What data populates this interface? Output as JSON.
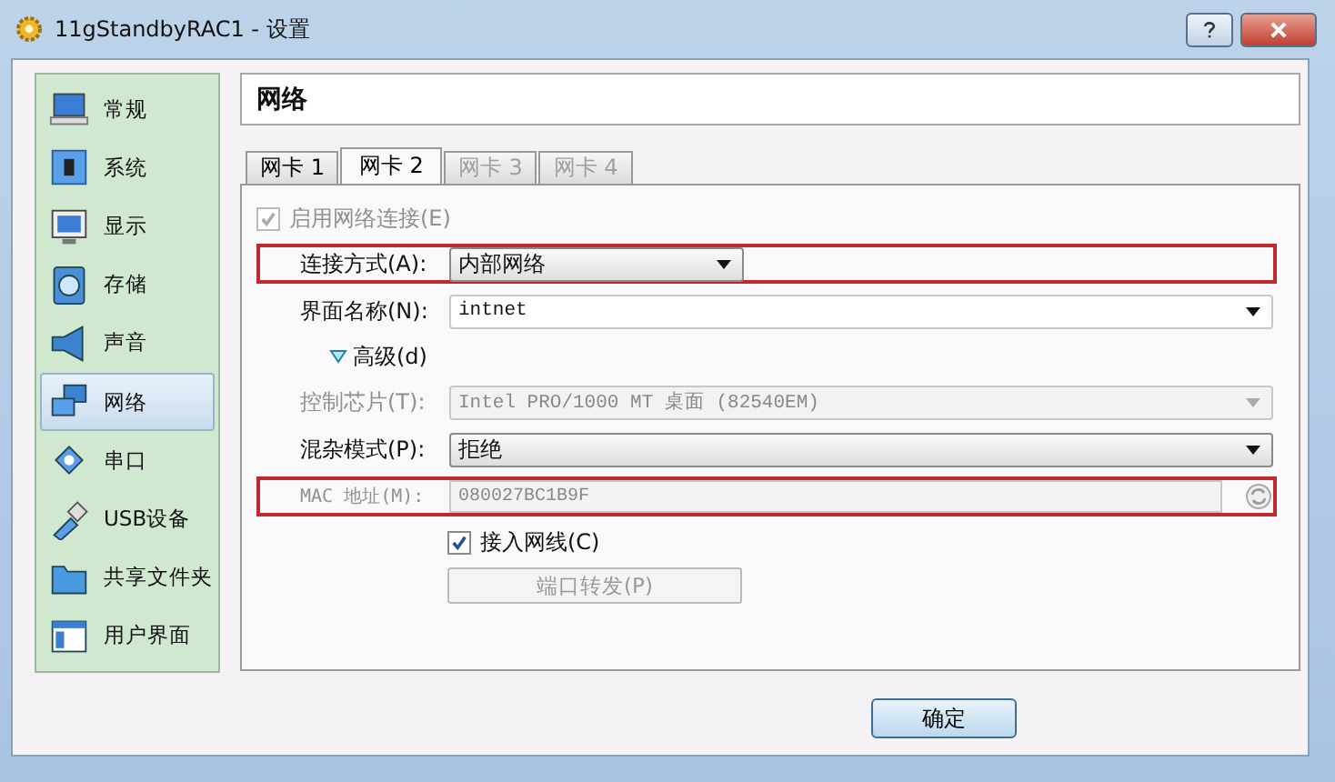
{
  "window": {
    "title": "11gStandbyRAC1 - 设置"
  },
  "sidebar": {
    "items": [
      {
        "label": "常规",
        "selected": false
      },
      {
        "label": "系统",
        "selected": false
      },
      {
        "label": "显示",
        "selected": false
      },
      {
        "label": "存储",
        "selected": false
      },
      {
        "label": "声音",
        "selected": false
      },
      {
        "label": "网络",
        "selected": true
      },
      {
        "label": "串口",
        "selected": false
      },
      {
        "label": "USB设备",
        "selected": false
      },
      {
        "label": "共享文件夹",
        "selected": false
      },
      {
        "label": "用户界面",
        "selected": false
      }
    ]
  },
  "page_title": "网络",
  "tabs": [
    {
      "label": "网卡 1",
      "selected": false,
      "disabled": false
    },
    {
      "label": "网卡 2",
      "selected": true,
      "disabled": false
    },
    {
      "label": "网卡 3",
      "selected": false,
      "disabled": true
    },
    {
      "label": "网卡 4",
      "selected": false,
      "disabled": true
    }
  ],
  "form": [
    {
      "kind": "checkbox",
      "label": "启用网络连接(E)",
      "checked": true,
      "disabled": true
    },
    {
      "kind": "combo",
      "label": "连接方式(A):",
      "value": "内部网络",
      "disabled": false,
      "highlighted": true
    },
    {
      "kind": "editcombo",
      "label": "界面名称(N):",
      "value": "intnet",
      "disabled": false,
      "highlighted": false
    },
    {
      "kind": "expander",
      "label": "高级(d)",
      "expanded": true
    },
    {
      "kind": "combo",
      "label": "控制芯片(T):",
      "value": "Intel PRO/1000 MT 桌面 (82540EM)",
      "disabled": true,
      "highlighted": false
    },
    {
      "kind": "combo",
      "label": "混杂模式(P):",
      "value": "拒绝",
      "disabled": false,
      "highlighted": false
    },
    {
      "kind": "text",
      "label": "MAC 地址(M):",
      "value": "080027BC1B9F",
      "disabled": true,
      "highlighted": true
    },
    {
      "kind": "check2",
      "label": "接入网线(C)",
      "checked": true,
      "disabled": false
    },
    {
      "kind": "button",
      "label": "端口转发(P)",
      "disabled": true
    }
  ],
  "buttons": [
    {
      "label": "确定"
    }
  ]
}
